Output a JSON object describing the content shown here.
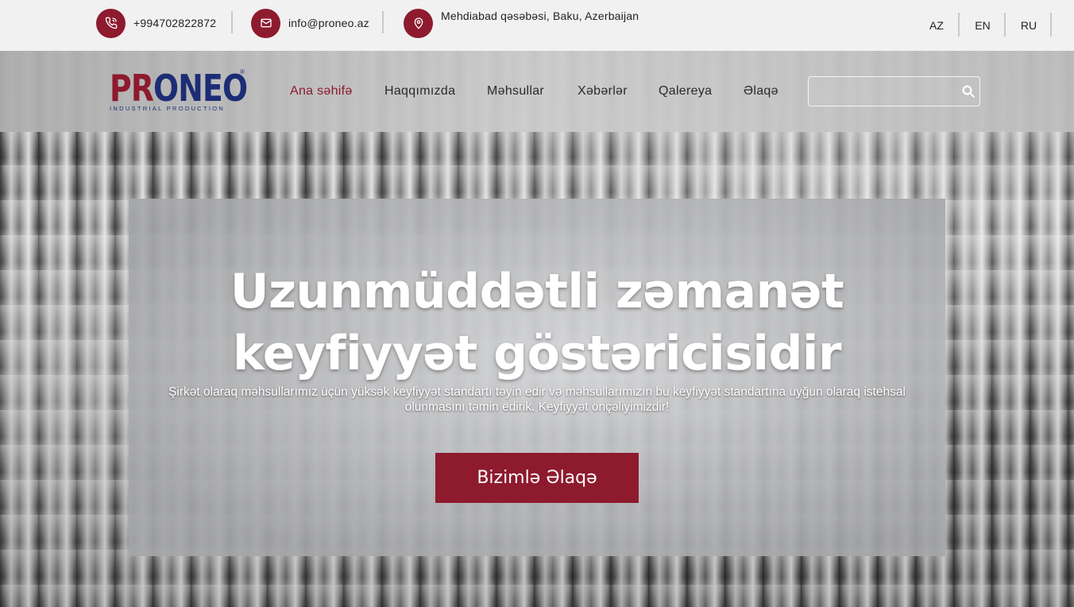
{
  "contacts": {
    "phone": "+994702822872",
    "email": "info@proneo.az",
    "address": "Mehdiabad qəsəbəsi, Baku, Azerbaijan"
  },
  "languages": [
    "AZ",
    "EN",
    "RU"
  ],
  "logo": {
    "part1": "PR",
    "part2": "ONEO",
    "tagline": "INDUSTRIAL PRODUCTION",
    "reg": "®"
  },
  "nav": {
    "items": [
      "Ana səhifə",
      "Haqqımızda",
      "Məhsullar",
      "Xəbərlər",
      "Qalereya",
      "Əlaqə"
    ],
    "active_index": 0
  },
  "search": {
    "placeholder": "",
    "icon": "search-icon"
  },
  "hero": {
    "headline_line1": "Uzunmüddətli zəmanət",
    "headline_line2": "keyfiyyət göstəricisidir",
    "subtitle": "Şirkət olaraq məhsullarımız üçün yüksək keyfiyyət standartı təyin edir və məhsullarımızın bu keyfiyyət standartına uyğun olaraq istehsal olunmasını təmin edirik. Keyfiyyət önçəliyimizdir!",
    "cta_label": "Bizimlə Əlaqə"
  },
  "colors": {
    "brand_red": "#8e1a2e",
    "brand_blue": "#1d2d75",
    "topbar_bg": "#f1f1f1"
  }
}
